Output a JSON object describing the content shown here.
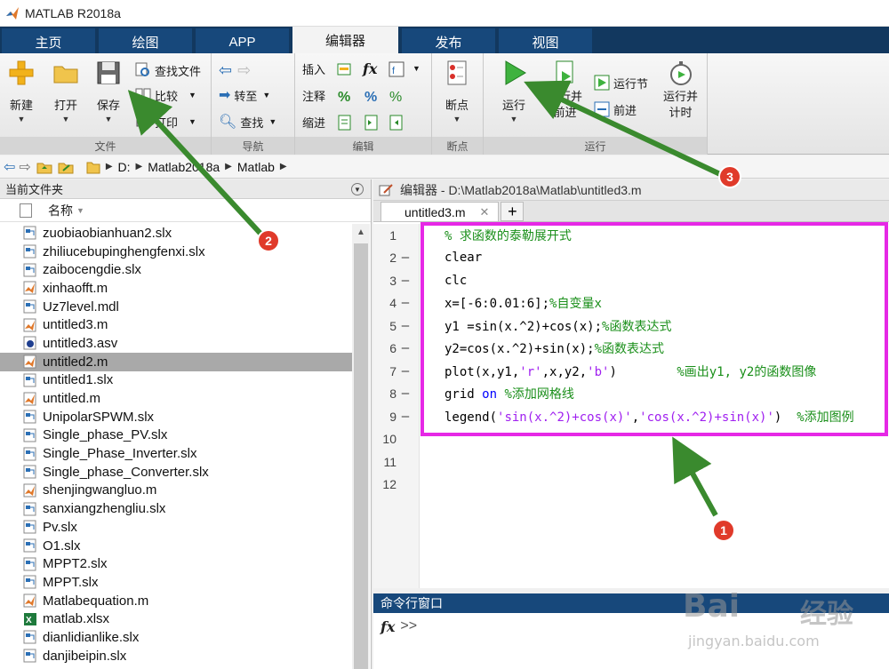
{
  "window": {
    "title": "MATLAB R2018a"
  },
  "tabs": [
    {
      "label": "主页"
    },
    {
      "label": "绘图"
    },
    {
      "label": "APP"
    },
    {
      "label": "编辑器"
    },
    {
      "label": "发布"
    },
    {
      "label": "视图"
    }
  ],
  "ribbon": {
    "file_group": {
      "label": "文件",
      "new_label": "新建",
      "open_label": "打开",
      "save_label": "保存",
      "find_files_label": "查找文件",
      "compare_label": "比较",
      "print_label": "打印"
    },
    "nav_group": {
      "label": "导航",
      "goto_label": "转至",
      "find_label": "查找"
    },
    "edit_group": {
      "label": "编辑",
      "insert_label": "插入",
      "comment_label": "注释",
      "indent_label": "缩进",
      "fx_label": "fx"
    },
    "breakpoint_group": {
      "label": "断点",
      "breakpoints_label": "断点"
    },
    "run_group": {
      "label": "运行",
      "run_label": "运行",
      "run_advance_label": "运行并\n前进",
      "run_section_label": "运行节",
      "advance_label": "前进",
      "run_time_label": "运行并\n计时"
    }
  },
  "addressbar": {
    "path": [
      "D:",
      "Matlab2018a",
      "Matlab"
    ]
  },
  "current_folder": {
    "title": "当前文件夹",
    "column_name": "名称",
    "files": [
      {
        "name": "zuobiaobianhuan2.slx",
        "type": "slx"
      },
      {
        "name": "zhiliucebupinghengfenxi.slx",
        "type": "slx"
      },
      {
        "name": "zaibocengdie.slx",
        "type": "slx"
      },
      {
        "name": "xinhaofft.m",
        "type": "m"
      },
      {
        "name": "Uz7level.mdl",
        "type": "slx"
      },
      {
        "name": "untitled3.m",
        "type": "m"
      },
      {
        "name": "untitled3.asv",
        "type": "asv"
      },
      {
        "name": "untitled2.m",
        "type": "m",
        "selected": true
      },
      {
        "name": "untitled1.slx",
        "type": "slx"
      },
      {
        "name": "untitled.m",
        "type": "m"
      },
      {
        "name": "UnipolarSPWM.slx",
        "type": "slx"
      },
      {
        "name": "Single_phase_PV.slx",
        "type": "slx"
      },
      {
        "name": "Single_Phase_Inverter.slx",
        "type": "slx"
      },
      {
        "name": "Single_phase_Converter.slx",
        "type": "slx"
      },
      {
        "name": "shenjingwangluo.m",
        "type": "m"
      },
      {
        "name": "sanxiangzhengliu.slx",
        "type": "slx"
      },
      {
        "name": "Pv.slx",
        "type": "slx"
      },
      {
        "name": "O1.slx",
        "type": "slx"
      },
      {
        "name": "MPPT2.slx",
        "type": "slx"
      },
      {
        "name": "MPPT.slx",
        "type": "slx"
      },
      {
        "name": "Matlabequation.m",
        "type": "m"
      },
      {
        "name": "matlab.xlsx",
        "type": "xlsx"
      },
      {
        "name": "dianlidianlike.slx",
        "type": "slx"
      },
      {
        "name": "danjibeipin.slx",
        "type": "slx"
      }
    ]
  },
  "editor": {
    "title": "编辑器 - D:\\Matlab2018a\\Matlab\\untitled3.m",
    "tab_label": "untitled3.m",
    "lines": [
      {
        "n": "1",
        "dash": "",
        "parts": [
          [
            "cmt",
            "% 求函数的泰勒展开式"
          ]
        ]
      },
      {
        "n": "2",
        "dash": "—",
        "parts": [
          [
            "plain",
            "clear"
          ]
        ]
      },
      {
        "n": "3",
        "dash": "—",
        "parts": [
          [
            "plain",
            "clc"
          ]
        ]
      },
      {
        "n": "4",
        "dash": "—",
        "parts": [
          [
            "plain",
            "x=[-6:0.01:6];"
          ],
          [
            "cmt",
            "%自变量x"
          ]
        ]
      },
      {
        "n": "5",
        "dash": "—",
        "parts": [
          [
            "plain",
            "y1 =sin(x.^2)+cos(x);"
          ],
          [
            "cmt",
            "%函数表达式"
          ]
        ]
      },
      {
        "n": "6",
        "dash": "—",
        "parts": [
          [
            "plain",
            "y2=cos(x.^2)+sin(x);"
          ],
          [
            "cmt",
            "%函数表达式"
          ]
        ]
      },
      {
        "n": "7",
        "dash": "—",
        "parts": [
          [
            "plain",
            "plot(x,y1,"
          ],
          [
            "str",
            "'r'"
          ],
          [
            "plain",
            ",x,y2,"
          ],
          [
            "str",
            "'b'"
          ],
          [
            "plain",
            ")        "
          ],
          [
            "cmt",
            "%画出y1, y2的函数图像"
          ]
        ]
      },
      {
        "n": "8",
        "dash": "—",
        "parts": [
          [
            "plain",
            "grid "
          ],
          [
            "kw",
            "on"
          ],
          [
            "plain",
            " "
          ],
          [
            "cmt",
            "%添加网格线"
          ]
        ]
      },
      {
        "n": "9",
        "dash": "—",
        "parts": [
          [
            "plain",
            "legend("
          ],
          [
            "str",
            "'sin(x.^2)+cos(x)'"
          ],
          [
            "plain",
            ","
          ],
          [
            "str",
            "'cos(x.^2)+sin(x)'"
          ],
          [
            "plain",
            ")  "
          ],
          [
            "cmt",
            "%添加图例"
          ]
        ]
      },
      {
        "n": "10",
        "dash": "",
        "parts": []
      },
      {
        "n": "11",
        "dash": "",
        "parts": []
      },
      {
        "n": "12",
        "dash": "",
        "parts": []
      }
    ]
  },
  "command_window": {
    "title": "命令行窗口",
    "fx": "fx",
    "prompt": ">>"
  },
  "annotations": {
    "badge1": "1",
    "badge2": "2",
    "badge3": "3",
    "highlight_color": "#e628e6",
    "arrow_color": "#3a8a2e"
  },
  "watermark": {
    "brand": "Bai",
    "suffix": "经验",
    "url": "jingyan.baidu.com"
  }
}
